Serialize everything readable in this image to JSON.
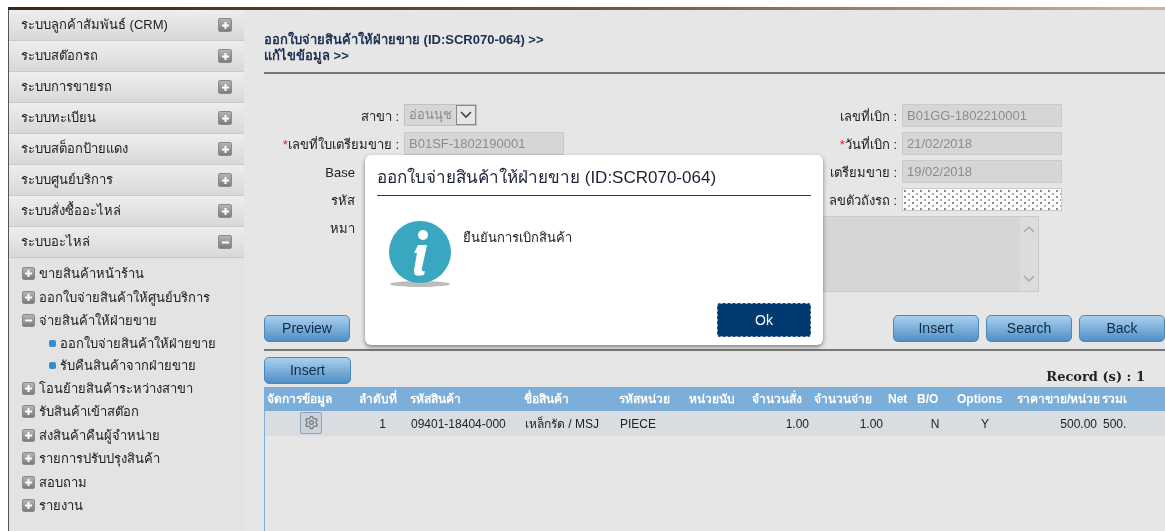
{
  "sidebar": {
    "modules": [
      {
        "label": "ระบบลูกค้าสัมพันธ์ (CRM)",
        "expanded": false
      },
      {
        "label": "ระบบสต๊อกรถ",
        "expanded": false
      },
      {
        "label": "ระบบการขายรถ",
        "expanded": false
      },
      {
        "label": "ระบบทะเบียน",
        "expanded": false
      },
      {
        "label": "ระบบสต็อกป้ายแดง",
        "expanded": false
      },
      {
        "label": "ระบบศูนย์บริการ",
        "expanded": false
      },
      {
        "label": "ระบบสั่งซื้ออะไหล่",
        "expanded": false
      },
      {
        "label": "ระบบอะไหล่",
        "expanded": true,
        "children": [
          {
            "label": "ขายสินค้าหน้าร้าน",
            "expanded": false
          },
          {
            "label": "ออกใบจ่ายสินค้าให้ศูนย์บริการ",
            "expanded": false
          },
          {
            "label": "จ่ายสินค้าให้ฝ่ายขาย",
            "expanded": true,
            "children": [
              {
                "label": "ออกใบจ่ายสินค้าให้ฝ่ายขาย"
              },
              {
                "label": "รับคืนสินค้าจากฝ่ายขาย"
              }
            ]
          },
          {
            "label": "โอนย้ายสินค้าระหว่างสาขา",
            "expanded": false
          },
          {
            "label": "รับสินค้าเข้าสต๊อก",
            "expanded": false
          },
          {
            "label": "ส่งสินค้าคืนผู้จำหน่าย",
            "expanded": false
          },
          {
            "label": "รายการปรับปรุงสินค้า",
            "expanded": false
          },
          {
            "label": "สอบถาม",
            "expanded": false
          },
          {
            "label": "รายงาน",
            "expanded": false
          }
        ]
      }
    ]
  },
  "page_title": [
    "ออกใบจ่ายสินค้าให้ฝ่ายขาย (ID:SCR070-064) >>",
    "แก้ไขข้อมูล >>"
  ],
  "form": {
    "rows": [
      {
        "left": {
          "label": "สาขา :",
          "kind": "select",
          "value": "อ่อนนุช"
        },
        "right": {
          "label": "เลขที่เบิก :",
          "kind": "text",
          "value": "B01GG-1802210001"
        }
      },
      {
        "left": {
          "required_mark": "*",
          "label": "เลขที่ใบเตรียมขาย :",
          "kind": "text",
          "value": "B01SF-1802190001"
        },
        "right": {
          "required_mark": "*",
          "label": "วันที่เบิก :",
          "kind": "text",
          "value": "21/02/2018"
        }
      },
      {
        "left": {
          "label": "Base",
          "kind": "hidden"
        },
        "right": {
          "label": "เตรียมขาย :",
          "kind": "text",
          "value": "19/02/2018"
        }
      },
      {
        "left": {
          "label": "รหัส",
          "kind": "hidden"
        },
        "right": {
          "label": "ลขตัวถังรถ :",
          "kind": "masked"
        }
      },
      {
        "left": {
          "label": "หมา",
          "kind": "textarea"
        }
      }
    ]
  },
  "buttons_left": [
    "Preview"
  ],
  "buttons_right": [
    "Insert",
    "Search",
    "Back"
  ],
  "detail": {
    "insert_button": "Insert",
    "record_count": "Record (s) : 1",
    "table": {
      "columns": [
        "จัดการข้อมูล",
        "ลำดับที่",
        "รหัสสินค้า",
        "ชื่อสินค้า",
        "รหัสหน่วย",
        "หน่วยนับ",
        "จำนวนสั่ง",
        "จำนวนจ่าย",
        "Net",
        "B/O",
        "Options",
        "ราคาขาย/หน่วย",
        "รวมเ"
      ],
      "rows": [
        {
          "cells": [
            "",
            "1",
            "09401-18404-000",
            "เหล็กรัด / MSJ",
            "PIECE",
            "",
            "1.00",
            "1.00",
            "",
            "N",
            "Y",
            "500.00",
            "500."
          ]
        }
      ]
    }
  },
  "dialog": {
    "title": "ออกใบจ่ายสินค้าให้ฝ่ายขาย (ID:SCR070-064)",
    "message": "ยืนยันการเบิกสินค้า",
    "ok": "Ok"
  }
}
